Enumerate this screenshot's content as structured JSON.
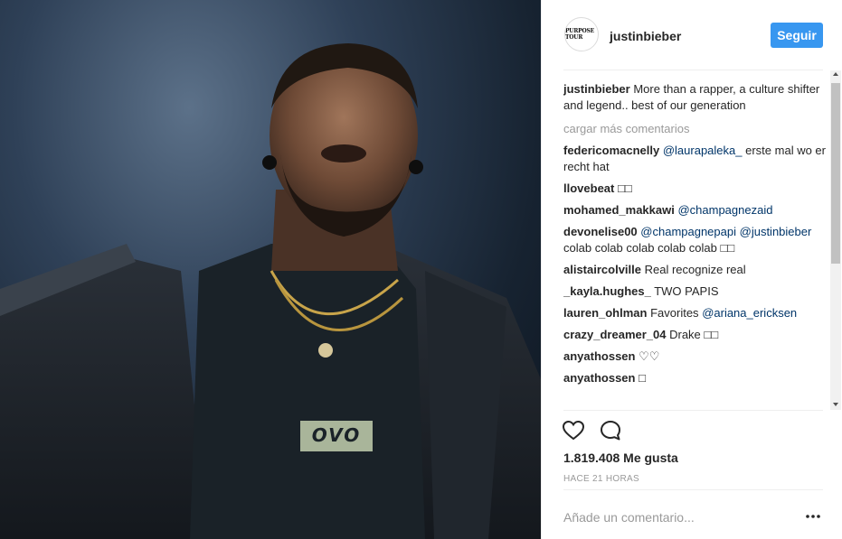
{
  "post": {
    "image_alt": "concert photo",
    "shirt_text": "OVO"
  },
  "header": {
    "avatar_text": "PURPOSE TOUR",
    "username": "justinbieber",
    "follow_label": "Seguir"
  },
  "caption": {
    "username": "justinbieber",
    "text": "More than a rapper, a culture shifter and legend.. best of our generation"
  },
  "load_more_label": "cargar más comentarios",
  "comments": [
    {
      "user": "federicomacnelly",
      "mention": "@laurapaleka_",
      "text": "erste mal wo er recht hat"
    },
    {
      "user": "llovebeat",
      "mention": "",
      "text": "□□"
    },
    {
      "user": "mohamed_makkawi",
      "mention": "@champagnezaid",
      "text": ""
    },
    {
      "user": "devonelise00",
      "mention": "@champagnepapi",
      "mention2": "@justinbieber",
      "text": "colab colab colab colab colab □□"
    },
    {
      "user": "alistaircolville",
      "mention": "",
      "text": "Real recognize real"
    },
    {
      "user": "_kayla.hughes_",
      "mention": "",
      "text": "TWO PAPIS"
    },
    {
      "user": "lauren_ohlman",
      "mention": "@ariana_ericksen",
      "text": "Favorites"
    },
    {
      "user": "crazy_dreamer_04",
      "mention": "",
      "text": "Drake □□"
    },
    {
      "user": "anyathossen",
      "mention": "",
      "text": "♡♡"
    },
    {
      "user": "anyathossen",
      "mention": "",
      "text": "□"
    }
  ],
  "actions": {
    "like_icon": "heart-icon",
    "comment_icon": "comment-icon"
  },
  "likes_label": "1.819.408 Me gusta",
  "time_label": "HACE 21 HORAS",
  "add_comment_placeholder": "Añade un comentario...",
  "colors": {
    "accent": "#3897f0",
    "mention": "#003569",
    "muted": "#999999"
  }
}
